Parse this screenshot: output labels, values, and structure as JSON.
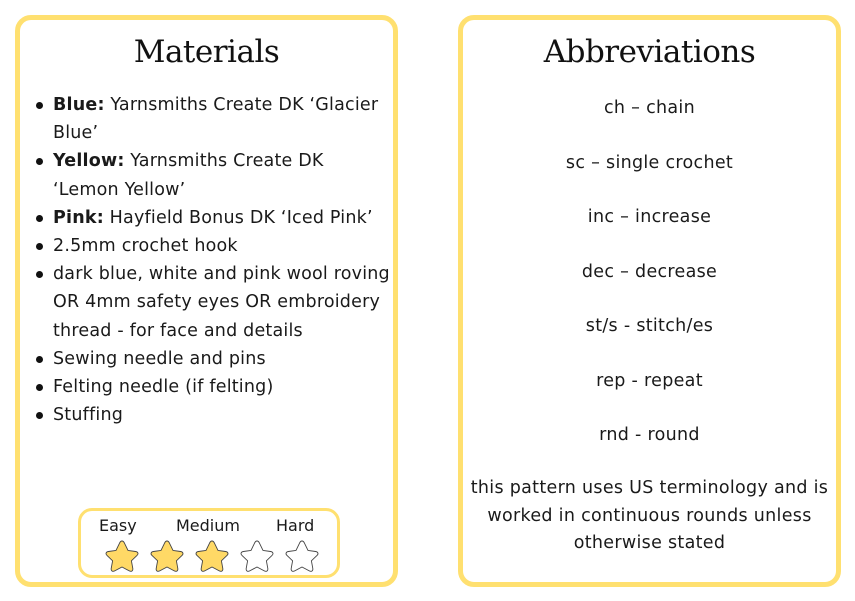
{
  "materials": {
    "title": "Materials",
    "items": [
      {
        "bold": "Blue:",
        "text": " Yarnsmiths Create DK ‘Glacier Blue’"
      },
      {
        "bold": "Yellow:",
        "text": " Yarnsmiths Create DK ‘Lemon Yellow’"
      },
      {
        "bold": "Pink:",
        "text": " Hayfield Bonus DK ‘Iced Pink’"
      },
      {
        "bold": "",
        "text": "2.5mm crochet hook"
      },
      {
        "bold": "",
        "text": "dark blue, white and pink wool roving OR 4mm safety eyes OR embroidery thread - for face and details"
      },
      {
        "bold": "",
        "text": "Sewing needle and pins"
      },
      {
        "bold": "",
        "text": "Felting needle (if felting)"
      },
      {
        "bold": "",
        "text": "Stuffing"
      }
    ],
    "difficulty": {
      "labels": {
        "easy": "Easy",
        "medium": "Medium",
        "hard": "Hard"
      },
      "rating": 3,
      "max": 5,
      "filled_color": "#FFD966",
      "empty_color": "#ffffff"
    }
  },
  "abbreviations": {
    "title": "Abbreviations",
    "items": [
      "ch – chain",
      "sc – single crochet",
      "inc – increase",
      "dec – decrease",
      "st/s - stitch/es",
      "rep - repeat",
      "rnd - round"
    ],
    "note": "this pattern uses US terminology and is worked in continuous rounds unless otherwise stated"
  },
  "colors": {
    "card_border": "#FFE070"
  }
}
